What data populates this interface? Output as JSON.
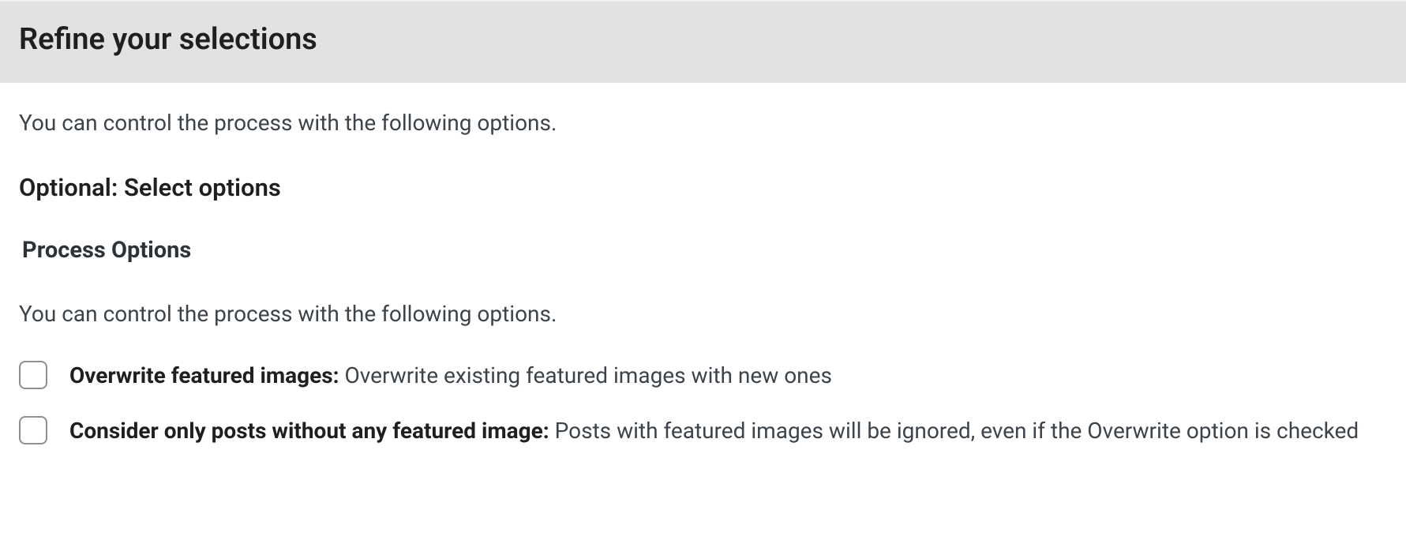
{
  "header": {
    "title": "Refine your selections"
  },
  "intro": "You can control the process with the following options.",
  "subheading": "Optional: Select options",
  "section_label": "Process Options",
  "desc": "You can control the process with the following options.",
  "options": [
    {
      "bold": "Overwrite featured images:",
      "text": " Overwrite existing featured images with new ones"
    },
    {
      "bold": "Consider only posts without any featured image:",
      "text": " Posts with featured images will be ignored, even if the Overwrite option is checked"
    }
  ]
}
